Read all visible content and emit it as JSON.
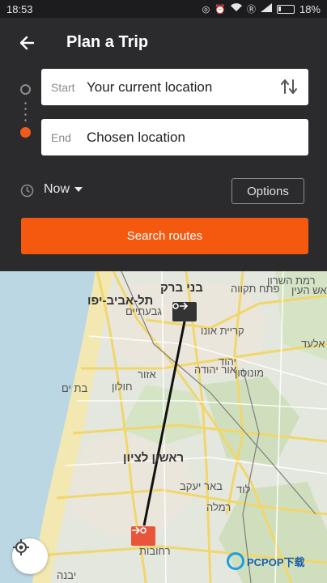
{
  "status_bar": {
    "time": "18:53",
    "battery": "18%",
    "icons": [
      "vpn-icon",
      "alarm-icon",
      "wifi-icon",
      "r-badge-icon",
      "signal-icon",
      "battery-icon"
    ]
  },
  "header": {
    "title": "Plan a Trip",
    "back_icon": "arrow-left-icon"
  },
  "trip": {
    "start_label": "Start",
    "start_value": "Your current location",
    "end_label": "End",
    "end_value": "Chosen location",
    "swap_icon": "swap-vertical-icon"
  },
  "time": {
    "value": "Now",
    "options_label": "Options"
  },
  "search_label": "Search routes",
  "colors": {
    "accent": "#f5580f",
    "header_bg": "#2b2b2d",
    "end_pin": "#e8553a"
  },
  "map": {
    "labels": [
      "תל-אביב-יפו",
      "בני ברק",
      "פתח תקווה",
      "גבעתיים",
      "רמת השרון",
      "קריית אונו",
      "יהוד",
      "אור יהודה",
      "אזור",
      "חולון",
      "בת ים",
      "ראשון לציון",
      "באר יעקב",
      "לוד",
      "רמלה",
      "רחובות",
      "אלעד",
      "ראש העין",
      "מונוסון",
      "יבנה"
    ]
  },
  "watermark": {
    "text": "PCPOP下载"
  }
}
